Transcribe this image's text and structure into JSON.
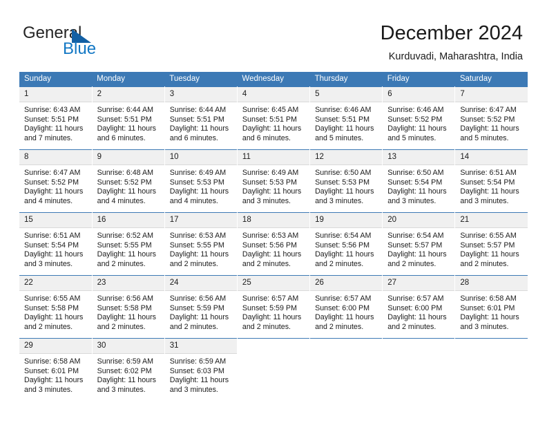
{
  "brand": {
    "name_part1": "General",
    "name_part2": "Blue",
    "flag_icon": "triangle-flag-icon",
    "accent_color": "#1277c4"
  },
  "header": {
    "title": "December 2024",
    "subtitle": "Kurduvadi, Maharashtra, India"
  },
  "colors": {
    "header_blue": "#3c79b5",
    "daynum_band": "#f0f0f0",
    "text": "#1a1a1a"
  },
  "weekdays": [
    "Sunday",
    "Monday",
    "Tuesday",
    "Wednesday",
    "Thursday",
    "Friday",
    "Saturday"
  ],
  "weeks": [
    [
      {
        "day": "1",
        "sunrise": "Sunrise: 6:43 AM",
        "sunset": "Sunset: 5:51 PM",
        "daylight1": "Daylight: 11 hours",
        "daylight2": "and 7 minutes."
      },
      {
        "day": "2",
        "sunrise": "Sunrise: 6:44 AM",
        "sunset": "Sunset: 5:51 PM",
        "daylight1": "Daylight: 11 hours",
        "daylight2": "and 6 minutes."
      },
      {
        "day": "3",
        "sunrise": "Sunrise: 6:44 AM",
        "sunset": "Sunset: 5:51 PM",
        "daylight1": "Daylight: 11 hours",
        "daylight2": "and 6 minutes."
      },
      {
        "day": "4",
        "sunrise": "Sunrise: 6:45 AM",
        "sunset": "Sunset: 5:51 PM",
        "daylight1": "Daylight: 11 hours",
        "daylight2": "and 6 minutes."
      },
      {
        "day": "5",
        "sunrise": "Sunrise: 6:46 AM",
        "sunset": "Sunset: 5:51 PM",
        "daylight1": "Daylight: 11 hours",
        "daylight2": "and 5 minutes."
      },
      {
        "day": "6",
        "sunrise": "Sunrise: 6:46 AM",
        "sunset": "Sunset: 5:52 PM",
        "daylight1": "Daylight: 11 hours",
        "daylight2": "and 5 minutes."
      },
      {
        "day": "7",
        "sunrise": "Sunrise: 6:47 AM",
        "sunset": "Sunset: 5:52 PM",
        "daylight1": "Daylight: 11 hours",
        "daylight2": "and 5 minutes."
      }
    ],
    [
      {
        "day": "8",
        "sunrise": "Sunrise: 6:47 AM",
        "sunset": "Sunset: 5:52 PM",
        "daylight1": "Daylight: 11 hours",
        "daylight2": "and 4 minutes."
      },
      {
        "day": "9",
        "sunrise": "Sunrise: 6:48 AM",
        "sunset": "Sunset: 5:52 PM",
        "daylight1": "Daylight: 11 hours",
        "daylight2": "and 4 minutes."
      },
      {
        "day": "10",
        "sunrise": "Sunrise: 6:49 AM",
        "sunset": "Sunset: 5:53 PM",
        "daylight1": "Daylight: 11 hours",
        "daylight2": "and 4 minutes."
      },
      {
        "day": "11",
        "sunrise": "Sunrise: 6:49 AM",
        "sunset": "Sunset: 5:53 PM",
        "daylight1": "Daylight: 11 hours",
        "daylight2": "and 3 minutes."
      },
      {
        "day": "12",
        "sunrise": "Sunrise: 6:50 AM",
        "sunset": "Sunset: 5:53 PM",
        "daylight1": "Daylight: 11 hours",
        "daylight2": "and 3 minutes."
      },
      {
        "day": "13",
        "sunrise": "Sunrise: 6:50 AM",
        "sunset": "Sunset: 5:54 PM",
        "daylight1": "Daylight: 11 hours",
        "daylight2": "and 3 minutes."
      },
      {
        "day": "14",
        "sunrise": "Sunrise: 6:51 AM",
        "sunset": "Sunset: 5:54 PM",
        "daylight1": "Daylight: 11 hours",
        "daylight2": "and 3 minutes."
      }
    ],
    [
      {
        "day": "15",
        "sunrise": "Sunrise: 6:51 AM",
        "sunset": "Sunset: 5:54 PM",
        "daylight1": "Daylight: 11 hours",
        "daylight2": "and 3 minutes."
      },
      {
        "day": "16",
        "sunrise": "Sunrise: 6:52 AM",
        "sunset": "Sunset: 5:55 PM",
        "daylight1": "Daylight: 11 hours",
        "daylight2": "and 2 minutes."
      },
      {
        "day": "17",
        "sunrise": "Sunrise: 6:53 AM",
        "sunset": "Sunset: 5:55 PM",
        "daylight1": "Daylight: 11 hours",
        "daylight2": "and 2 minutes."
      },
      {
        "day": "18",
        "sunrise": "Sunrise: 6:53 AM",
        "sunset": "Sunset: 5:56 PM",
        "daylight1": "Daylight: 11 hours",
        "daylight2": "and 2 minutes."
      },
      {
        "day": "19",
        "sunrise": "Sunrise: 6:54 AM",
        "sunset": "Sunset: 5:56 PM",
        "daylight1": "Daylight: 11 hours",
        "daylight2": "and 2 minutes."
      },
      {
        "day": "20",
        "sunrise": "Sunrise: 6:54 AM",
        "sunset": "Sunset: 5:57 PM",
        "daylight1": "Daylight: 11 hours",
        "daylight2": "and 2 minutes."
      },
      {
        "day": "21",
        "sunrise": "Sunrise: 6:55 AM",
        "sunset": "Sunset: 5:57 PM",
        "daylight1": "Daylight: 11 hours",
        "daylight2": "and 2 minutes."
      }
    ],
    [
      {
        "day": "22",
        "sunrise": "Sunrise: 6:55 AM",
        "sunset": "Sunset: 5:58 PM",
        "daylight1": "Daylight: 11 hours",
        "daylight2": "and 2 minutes."
      },
      {
        "day": "23",
        "sunrise": "Sunrise: 6:56 AM",
        "sunset": "Sunset: 5:58 PM",
        "daylight1": "Daylight: 11 hours",
        "daylight2": "and 2 minutes."
      },
      {
        "day": "24",
        "sunrise": "Sunrise: 6:56 AM",
        "sunset": "Sunset: 5:59 PM",
        "daylight1": "Daylight: 11 hours",
        "daylight2": "and 2 minutes."
      },
      {
        "day": "25",
        "sunrise": "Sunrise: 6:57 AM",
        "sunset": "Sunset: 5:59 PM",
        "daylight1": "Daylight: 11 hours",
        "daylight2": "and 2 minutes."
      },
      {
        "day": "26",
        "sunrise": "Sunrise: 6:57 AM",
        "sunset": "Sunset: 6:00 PM",
        "daylight1": "Daylight: 11 hours",
        "daylight2": "and 2 minutes."
      },
      {
        "day": "27",
        "sunrise": "Sunrise: 6:57 AM",
        "sunset": "Sunset: 6:00 PM",
        "daylight1": "Daylight: 11 hours",
        "daylight2": "and 2 minutes."
      },
      {
        "day": "28",
        "sunrise": "Sunrise: 6:58 AM",
        "sunset": "Sunset: 6:01 PM",
        "daylight1": "Daylight: 11 hours",
        "daylight2": "and 3 minutes."
      }
    ],
    [
      {
        "day": "29",
        "sunrise": "Sunrise: 6:58 AM",
        "sunset": "Sunset: 6:01 PM",
        "daylight1": "Daylight: 11 hours",
        "daylight2": "and 3 minutes."
      },
      {
        "day": "30",
        "sunrise": "Sunrise: 6:59 AM",
        "sunset": "Sunset: 6:02 PM",
        "daylight1": "Daylight: 11 hours",
        "daylight2": "and 3 minutes."
      },
      {
        "day": "31",
        "sunrise": "Sunrise: 6:59 AM",
        "sunset": "Sunset: 6:03 PM",
        "daylight1": "Daylight: 11 hours",
        "daylight2": "and 3 minutes."
      },
      {
        "day": "",
        "sunrise": "",
        "sunset": "",
        "daylight1": "",
        "daylight2": ""
      },
      {
        "day": "",
        "sunrise": "",
        "sunset": "",
        "daylight1": "",
        "daylight2": ""
      },
      {
        "day": "",
        "sunrise": "",
        "sunset": "",
        "daylight1": "",
        "daylight2": ""
      },
      {
        "day": "",
        "sunrise": "",
        "sunset": "",
        "daylight1": "",
        "daylight2": ""
      }
    ]
  ]
}
